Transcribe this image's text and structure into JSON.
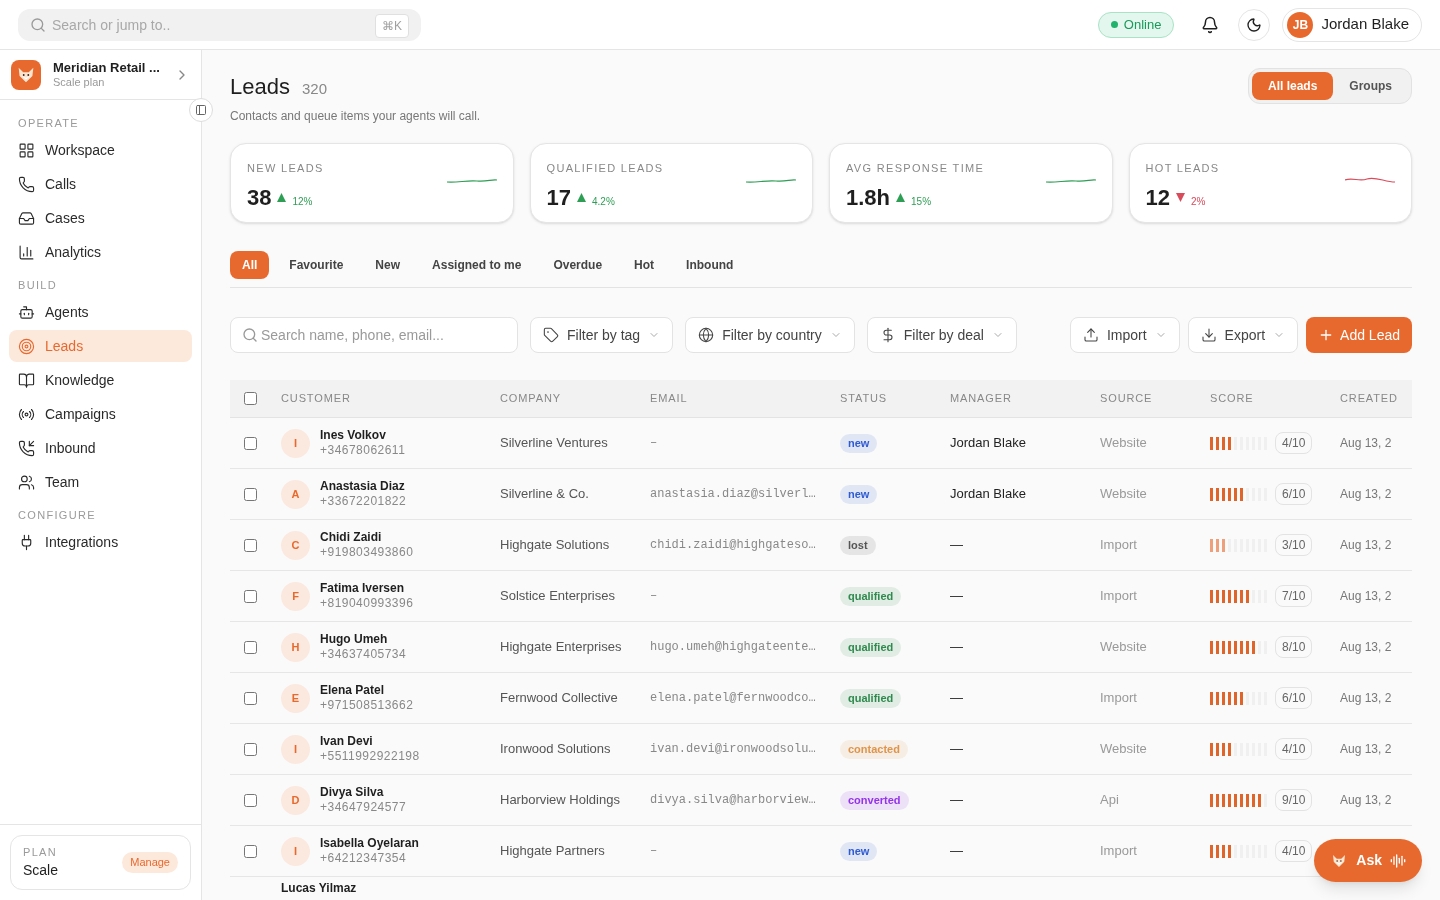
{
  "topbar": {
    "search": {
      "placeholder": "Search or jump to..",
      "shortcut": "⌘K"
    },
    "status": {
      "label": "Online",
      "on": true
    },
    "user": {
      "initials": "JB",
      "name": "Jordan Blake"
    }
  },
  "sidebar": {
    "org": {
      "name": "Meridian Retail ...",
      "plan": "Scale plan"
    },
    "sections": [
      {
        "title": "OPERATE",
        "items": [
          {
            "label": "Workspace",
            "selected": false
          },
          {
            "label": "Calls",
            "selected": false
          },
          {
            "label": "Cases",
            "selected": false
          },
          {
            "label": "Analytics",
            "selected": false
          }
        ]
      },
      {
        "title": "BUILD",
        "items": [
          {
            "label": "Agents",
            "selected": false
          },
          {
            "label": "Leads",
            "selected": true
          },
          {
            "label": "Knowledge",
            "selected": false
          },
          {
            "label": "Campaigns",
            "selected": false
          },
          {
            "label": "Inbound",
            "selected": false
          },
          {
            "label": "Team",
            "selected": false
          }
        ]
      },
      {
        "title": "CONFIGURE",
        "items": [
          {
            "label": "Integrations",
            "selected": false
          }
        ]
      }
    ],
    "plan": {
      "label": "PLAN",
      "name": "Scale",
      "action": "Manage"
    }
  },
  "header": {
    "title": "Leads",
    "count": "320",
    "subtitle": "Contacts and queue items your agents will call.",
    "views": [
      {
        "label": "All leads",
        "selected": true
      },
      {
        "label": "Groups",
        "selected": false
      }
    ]
  },
  "stats": [
    {
      "label": "NEW LEADS",
      "value": "38",
      "change": "12%",
      "kind": "up"
    },
    {
      "label": "QUALIFIED LEADS",
      "value": "17",
      "change": "4.2%",
      "kind": "up"
    },
    {
      "label": "AVG RESPONSE TIME",
      "value": "1.8h",
      "change": "15%",
      "kind": "up"
    },
    {
      "label": "HOT LEADS",
      "value": "12",
      "change": "2%",
      "kind": "down"
    }
  ],
  "filters": [
    {
      "label": "All",
      "selected": true
    },
    {
      "label": "Favourite",
      "selected": false
    },
    {
      "label": "New",
      "selected": false
    },
    {
      "label": "Assigned to me",
      "selected": false
    },
    {
      "label": "Overdue",
      "selected": false
    },
    {
      "label": "Hot",
      "selected": false
    },
    {
      "label": "Inbound",
      "selected": false
    }
  ],
  "toolbar": {
    "search": {
      "placeholder": "Search name, phone, email..."
    },
    "dropdowns": [
      {
        "label": "Filter by tag"
      },
      {
        "label": "Filter by country"
      },
      {
        "label": "Filter by deal"
      }
    ],
    "actions": [
      {
        "label": "Import"
      },
      {
        "label": "Export"
      }
    ],
    "primary": "Add Lead"
  },
  "table": {
    "columns": [
      "CUSTOMER",
      "COMPANY",
      "EMAIL",
      "STATUS",
      "MANAGER",
      "SOURCE",
      "SCORE",
      "CREATED"
    ],
    "all_checked": false,
    "rows": [
      {
        "checked": false,
        "initial": "I",
        "name": "Ines Volkov",
        "phone": "+34678062611",
        "company": "Silverline Ventures",
        "email": "–",
        "status": {
          "label": "new",
          "color": "#2f5bd3"
        },
        "manager": "Jordan Blake",
        "source": "Website",
        "level": 0.4,
        "score": "4/10",
        "created": "Aug 13, 2"
      },
      {
        "checked": false,
        "initial": "A",
        "name": "Anastasia Diaz",
        "phone": "+33672201822",
        "company": "Silverline & Co.",
        "email": "anastasia.diaz@silverl…",
        "status": {
          "label": "new",
          "color": "#2f5bd3"
        },
        "manager": "Jordan Blake",
        "source": "Website",
        "level": 0.6,
        "score": "6/10",
        "created": "Aug 13, 2"
      },
      {
        "checked": false,
        "initial": "C",
        "name": "Chidi Zaidi",
        "phone": "+919803493860",
        "company": "Highgate Solutions",
        "email": "chidi.zaidi@highgateso…",
        "status": {
          "label": "lost",
          "color": "#555555"
        },
        "manager": "—",
        "source": "Import",
        "level": 0.3,
        "score": "3/10",
        "created": "Aug 13, 2"
      },
      {
        "checked": false,
        "initial": "F",
        "name": "Fatima Iversen",
        "phone": "+819040993396",
        "company": "Solstice Enterprises",
        "email": "–",
        "status": {
          "label": "qualified",
          "color": "#2f8a4e"
        },
        "manager": "—",
        "source": "Import",
        "level": 0.7,
        "score": "7/10",
        "created": "Aug 13, 2"
      },
      {
        "checked": false,
        "initial": "H",
        "name": "Hugo Umeh",
        "phone": "+34637405734",
        "company": "Highgate Enterprises",
        "email": "hugo.umeh@highgateente…",
        "status": {
          "label": "qualified",
          "color": "#2f8a4e"
        },
        "manager": "—",
        "source": "Website",
        "level": 0.8,
        "score": "8/10",
        "created": "Aug 13, 2"
      },
      {
        "checked": false,
        "initial": "E",
        "name": "Elena Patel",
        "phone": "+971508513662",
        "company": "Fernwood Collective",
        "email": "elena.patel@fernwoodco…",
        "status": {
          "label": "qualified",
          "color": "#2f8a4e"
        },
        "manager": "—",
        "source": "Import",
        "level": 0.6,
        "score": "6/10",
        "created": "Aug 13, 2"
      },
      {
        "checked": false,
        "initial": "I",
        "name": "Ivan Devi",
        "phone": "+5511992922198",
        "company": "Ironwood Solutions",
        "email": "ivan.devi@ironwoodsolu…",
        "status": {
          "label": "contacted",
          "color": "#e0944a"
        },
        "manager": "—",
        "source": "Website",
        "level": 0.4,
        "score": "4/10",
        "created": "Aug 13, 2"
      },
      {
        "checked": false,
        "initial": "D",
        "name": "Divya Silva",
        "phone": "+34647924577",
        "company": "Harborview Holdings",
        "email": "divya.silva@harborview…",
        "status": {
          "label": "converted",
          "color": "#9333ea"
        },
        "manager": "—",
        "source": "Api",
        "level": 0.9,
        "score": "9/10",
        "created": "Aug 13, 2"
      },
      {
        "checked": false,
        "initial": "I",
        "name": "Isabella Oyelaran",
        "phone": "+64212347354",
        "company": "Highgate Partners",
        "email": "–",
        "status": {
          "label": "new",
          "color": "#2f5bd3"
        },
        "manager": "—",
        "source": "Import",
        "level": 0.4,
        "score": "4/10"
      },
      {
        "name": "Lucas Yilmaz"
      }
    ]
  },
  "assistant": {
    "label": "Ask"
  }
}
